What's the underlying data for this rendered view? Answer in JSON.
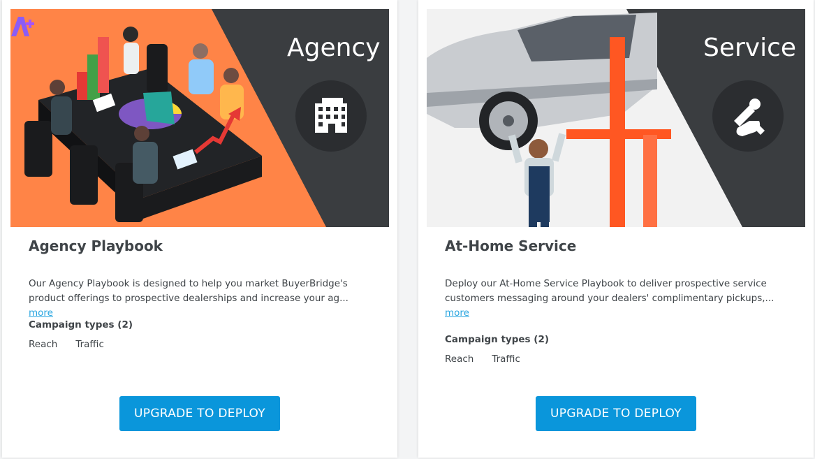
{
  "cards": [
    {
      "hero_label": "Agency",
      "hero_icon": "building-icon",
      "title": "Agency Playbook",
      "description": "Our Agency Playbook is designed to help you market BuyerBridge's product offerings to prospective dealerships and increase your ag...",
      "more_label": " more",
      "campaign_types_label": "Campaign types (2)",
      "campaign_types": [
        "Reach",
        "Traffic"
      ],
      "button_label": "UPGRADE TO DEPLOY",
      "badge_icon": "a-plus-icon"
    },
    {
      "hero_label": "Service",
      "hero_icon": "wrench-hand-icon",
      "title": "At-Home Service",
      "description": "Deploy our At-Home Service Playbook to deliver prospective service customers messaging around your dealers' complimentary pickups,...",
      "more_label": "more",
      "campaign_types_label": "Campaign types (2)",
      "campaign_types": [
        "Reach",
        "Traffic"
      ],
      "button_label": "UPGRADE TO DEPLOY"
    }
  ],
  "colors": {
    "accent_blue": "#0a96db",
    "link_blue": "#2aa6e0",
    "agency_orange": "#ff8447",
    "hero_dark": "#3a3d40",
    "badge_purple": "#8b5cf6"
  }
}
